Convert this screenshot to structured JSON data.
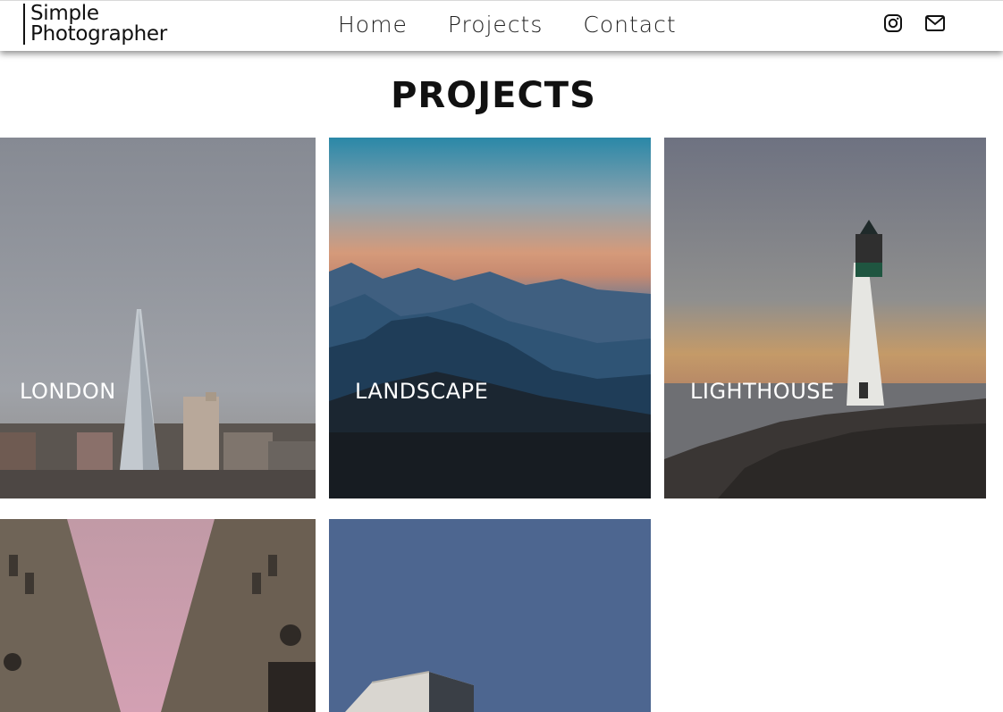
{
  "header": {
    "logo_line1": "Simple",
    "logo_line2": "Photographer",
    "nav": [
      {
        "label": "Home"
      },
      {
        "label": "Projects"
      },
      {
        "label": "Contact"
      }
    ],
    "social": [
      {
        "icon": "instagram-icon"
      },
      {
        "icon": "mail-icon"
      }
    ]
  },
  "main": {
    "title": "PROJECTS",
    "projects": [
      {
        "label": "LONDON"
      },
      {
        "label": "LANDSCAPE"
      },
      {
        "label": "LIGHTHOUSE"
      },
      {
        "label": ""
      },
      {
        "label": ""
      }
    ]
  },
  "colors": {
    "text": "#111111",
    "overlay_text": "#ffffff",
    "page_bg": "#ffffff"
  }
}
